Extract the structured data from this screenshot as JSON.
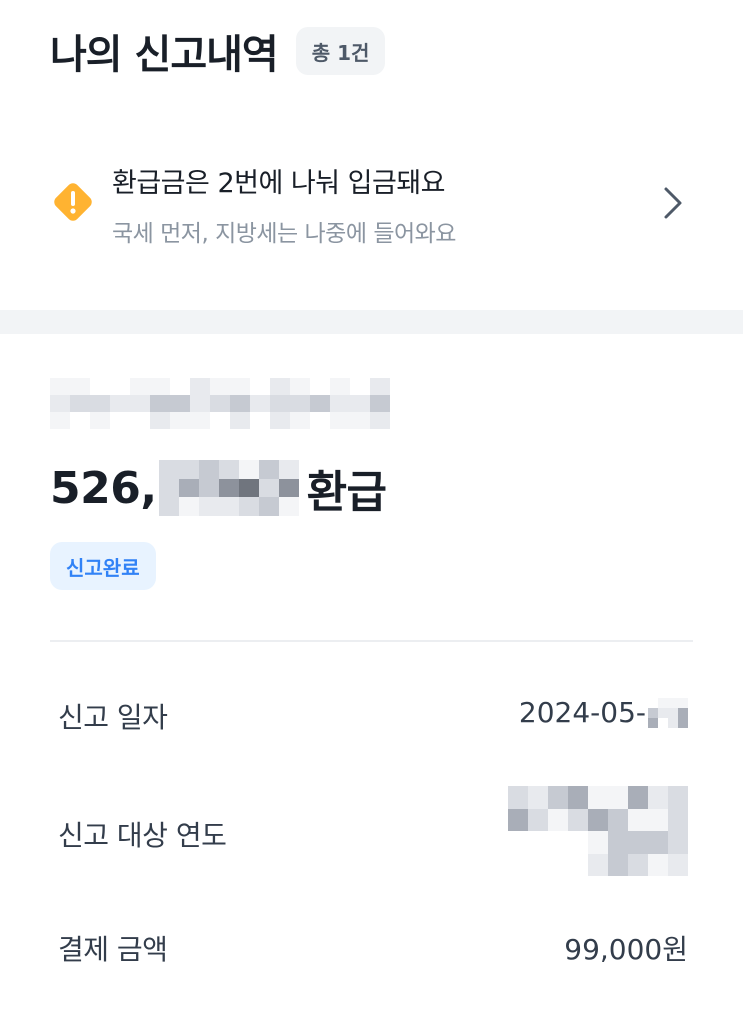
{
  "header": {
    "title": "나의 신고내역",
    "count_badge": "총 1건"
  },
  "notice": {
    "icon": "warning-icon",
    "title": "환급금은 2번에 나눠 입금돼요",
    "subtitle": "국세 먼저, 지방세는 나중에 들어와요",
    "accent_color": "#ffb331"
  },
  "report": {
    "amount_prefix": "526,",
    "amount_suffix": "환급",
    "status": "신고완료",
    "status_color": "#3182f6",
    "rows": [
      {
        "label": "신고 일자",
        "value": "2024-05-"
      },
      {
        "label": "신고 대상 연도",
        "value": ""
      },
      {
        "label": "결제 금액",
        "value": "99,000원"
      }
    ]
  }
}
